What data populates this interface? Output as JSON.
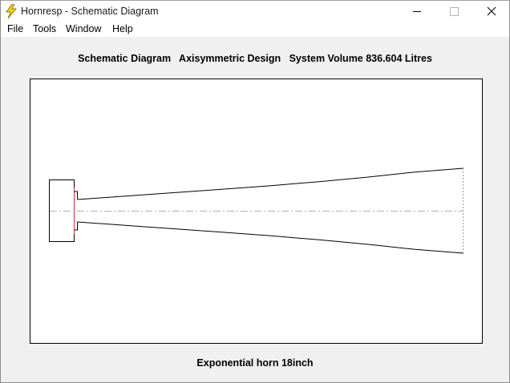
{
  "window": {
    "title": "Hornresp - Schematic Diagram",
    "app_icon": "lightning-bolt-icon",
    "controls": {
      "minimize_icon": "minimize-icon",
      "maximize_icon": "maximize-icon",
      "close_icon": "close-icon"
    }
  },
  "menubar": {
    "items": [
      {
        "label": "File"
      },
      {
        "label": "Tools"
      },
      {
        "label": "Window"
      },
      {
        "label": "Help"
      }
    ]
  },
  "diagram": {
    "header": "Schematic Diagram   Axisymmetric Design   System Volume 836.604 Litres",
    "footer": "Exponential horn 18inch",
    "colors": {
      "outline": "#000000",
      "axis": "#b0b0b0",
      "driver_diaphragm": "#d03030",
      "mouth": "#999999"
    }
  }
}
